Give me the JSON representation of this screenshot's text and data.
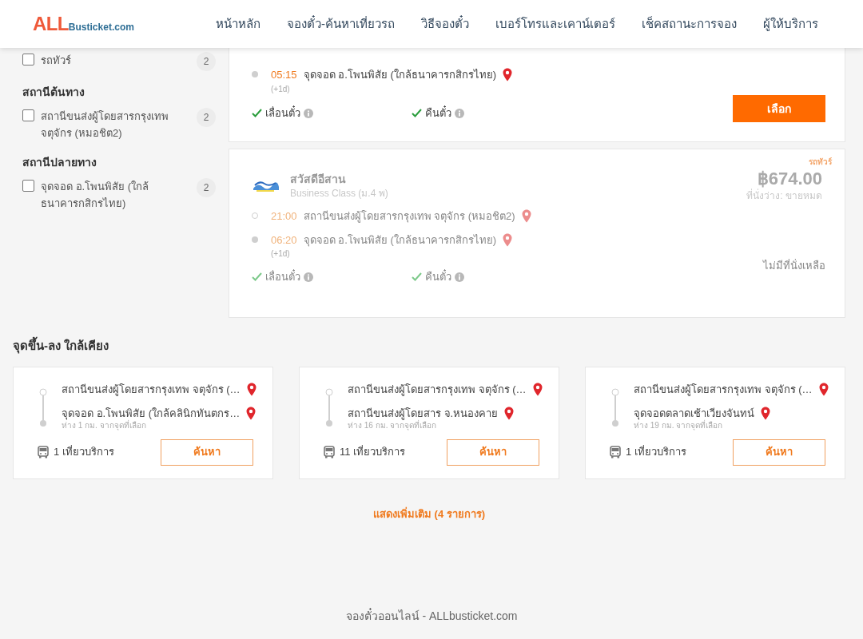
{
  "header": {
    "logo": {
      "mark": "ALL",
      "text": "Busticket.com"
    },
    "nav": [
      "หน้าหลัก",
      "จองตั๋ว-ค้นหาเที่ยวรถ",
      "วิธีจองตั๋ว",
      "เบอร์โทรและเคาน์เตอร์",
      "เช็คสถานะการจอง",
      "ผู้ให้บริการ"
    ]
  },
  "filters": [
    {
      "items": [
        {
          "label": "รถทัวร์",
          "count": "2",
          "checked": false
        }
      ]
    },
    {
      "title": "สถานีต้นทาง",
      "items": [
        {
          "label": "สถานีขนส่งผู้โดยสารกรุงเทพ จตุจักร (หมอชิต2)",
          "count": "2",
          "checked": false
        }
      ]
    },
    {
      "title": "สถานีปลายทาง",
      "items": [
        {
          "label": "จุดจอด อ.โพนพิสัย (ใกล้ธนาคารกสิกรไทย)",
          "count": "2",
          "checked": false
        }
      ]
    }
  ],
  "trips": [
    {
      "available": true,
      "stops": [
        {
          "time": "05:15",
          "place": "จุดจอด อ.โพนพิสัย (ใกล้ธนาคารกสิกรไทย)",
          "next_day": "(+1d)"
        }
      ],
      "features": [
        {
          "label": "เลื่อนตั๋ว"
        },
        {
          "label": "คืนตั๋ว"
        }
      ],
      "action": "เลือก"
    },
    {
      "available": false,
      "tag": "รถทัวร์",
      "operator": "สวัสดีอีสาน",
      "class": "Business Class (ม.4 พ)",
      "logo": {
        "kind": "picture"
      },
      "price": "฿674.00",
      "seats": "ที่นั่งว่าง: ขายหมด",
      "stops": [
        {
          "time": "21:00",
          "place": "สถานีขนส่งผู้โดยสารกรุงเทพ จตุจักร (หมอชิต2)"
        },
        {
          "time": "06:20",
          "place": "จุดจอด อ.โพนพิสัย (ใกล้ธนาคารกสิกรไทย)",
          "next_day": "(+1d)"
        }
      ],
      "features": [
        {
          "label": "เลื่อนตั๋ว"
        },
        {
          "label": "คืนตั๋ว"
        }
      ],
      "status": "ไม่มีที่นั่งเหลือ"
    }
  ],
  "nearby": {
    "title": "จุดขึ้น-ลง ใกล้เคียง",
    "cards": [
      {
        "from": "สถานีขนส่งผู้โดยสารกรุงเทพ จตุจักร (…",
        "to": "จุดจอด อ.โพนพิสัย (ใกล้คลินิกทันตกร…",
        "distance": "ห่าง 1 กม. จากจุดที่เลือก",
        "trips": "1 เที่ยวบริการ",
        "button": "ค้นหา"
      },
      {
        "from": "สถานีขนส่งผู้โดยสารกรุงเทพ จตุจักร (…",
        "to": "สถานีขนส่งผู้โดยสาร จ.หนองคาย",
        "distance": "ห่าง 16 กม. จากจุดที่เลือก",
        "trips": "11 เที่ยวบริการ",
        "button": "ค้นหา"
      },
      {
        "from": "สถานีขนส่งผู้โดยสารกรุงเทพ จตุจักร (…",
        "to": "จุดจอดตลาดเช้าเวียงจันทน์",
        "distance": "ห่าง 19 กม. จากจุดที่เลือก",
        "trips": "1 เที่ยวบริการ",
        "button": "ค้นหา"
      }
    ],
    "more": "แสดงเพิ่มเติม (4 รายการ)"
  },
  "footer": "จองตั๋วออนไลน์ - ALLbusticket.com"
}
